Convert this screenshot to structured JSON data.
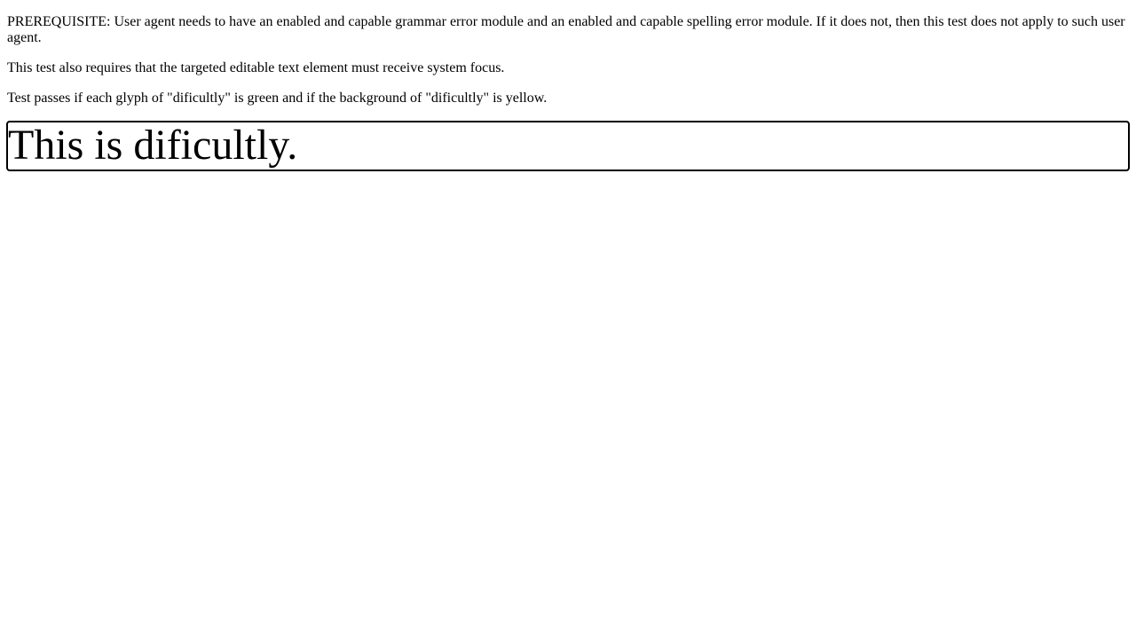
{
  "instructions": {
    "prerequisite": "PREREQUISITE: User agent needs to have an enabled and capable grammar error module and an enabled and capable spelling error module. If it does not, then this test does not apply to such user agent.",
    "focus_requirement": "This test also requires that the targeted editable text element must receive system focus.",
    "pass_condition": "Test passes if each glyph of \"dificultly\" is green and if the background of \"dificultly\" is yellow."
  },
  "editable": {
    "text": "This is dificultly."
  }
}
